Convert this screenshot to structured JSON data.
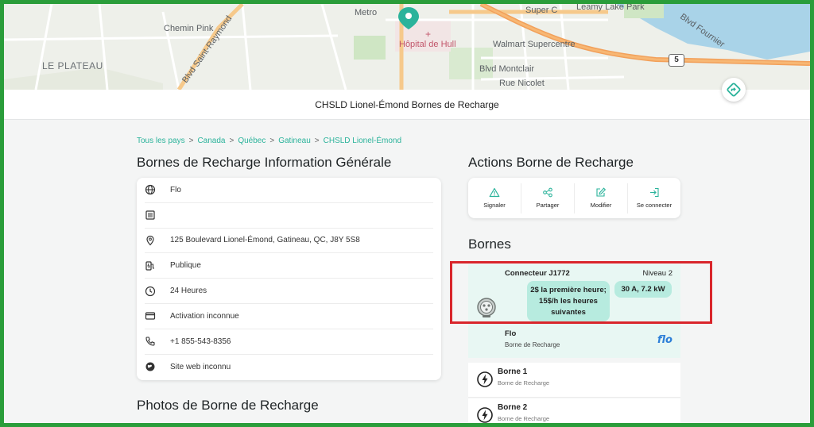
{
  "map": {
    "labels": {
      "metro": "Metro",
      "super_c": "Super C",
      "leamy": "Leamy Lake Park",
      "fournier": "Blvd Fournier",
      "chemin_pink": "Chemin Pink",
      "saint_raymond": "Blvd Saint-Raymond",
      "hopital": "Hôpital de Hull",
      "walmart": "Walmart Supercentre",
      "le_plateau": "LE PLATEAU",
      "montclair": "Blvd Montclair",
      "nicolet": "Rue Nicolet",
      "route": "5"
    }
  },
  "header": {
    "title": "CHSLD Lionel-Émond Bornes de Recharge"
  },
  "breadcrumb": {
    "items": [
      "Tous les pays",
      "Canada",
      "Québec",
      "Gatineau",
      "CHSLD Lionel-Émond"
    ],
    "separator": ">"
  },
  "info": {
    "heading": "Bornes de Recharge Information Générale",
    "rows": [
      {
        "icon": "globe-icon",
        "text": "Flo"
      },
      {
        "icon": "list-icon",
        "text": ""
      },
      {
        "icon": "location-pin-icon",
        "text": "125 Boulevard Lionel-Émond, Gatineau, QC, J8Y 5S8"
      },
      {
        "icon": "charging-station-icon",
        "text": "Publique"
      },
      {
        "icon": "clock-icon",
        "text": "24 Heures"
      },
      {
        "icon": "credit-card-icon",
        "text": "Activation inconnue"
      },
      {
        "icon": "phone-icon",
        "text": "+1 855-543-8356"
      },
      {
        "icon": "web-icon",
        "text": "Site web inconnu"
      }
    ]
  },
  "photos": {
    "heading": "Photos de Borne de Recharge"
  },
  "actions": {
    "heading": "Actions Borne de Recharge",
    "items": [
      {
        "icon": "warning-icon",
        "label": "Signaler"
      },
      {
        "icon": "share-icon",
        "label": "Partager"
      },
      {
        "icon": "edit-icon",
        "label": "Modifier"
      },
      {
        "icon": "login-icon",
        "label": "Se connecter"
      }
    ]
  },
  "bornes": {
    "heading": "Bornes",
    "connector": {
      "title": "Connecteur J1772",
      "level": "Niveau 2",
      "price_line1": "2$ la première heure;",
      "price_line2": "15$/h les heures",
      "price_line3": "suivantes",
      "power": "30 A, 7.2 kW"
    },
    "network": {
      "name": "Flo",
      "type": "Borne de Recharge",
      "logo": "flo"
    },
    "stations": [
      {
        "name": "Borne 1",
        "type": "Borne de Recharge"
      },
      {
        "name": "Borne 2",
        "type": "Borne de Recharge"
      }
    ]
  },
  "colors": {
    "accent": "#2bb39b",
    "highlight": "#d9252b",
    "frame": "#2a9d3a",
    "connector_bg": "#e8f7f3",
    "chip": "#b7ebdf"
  }
}
